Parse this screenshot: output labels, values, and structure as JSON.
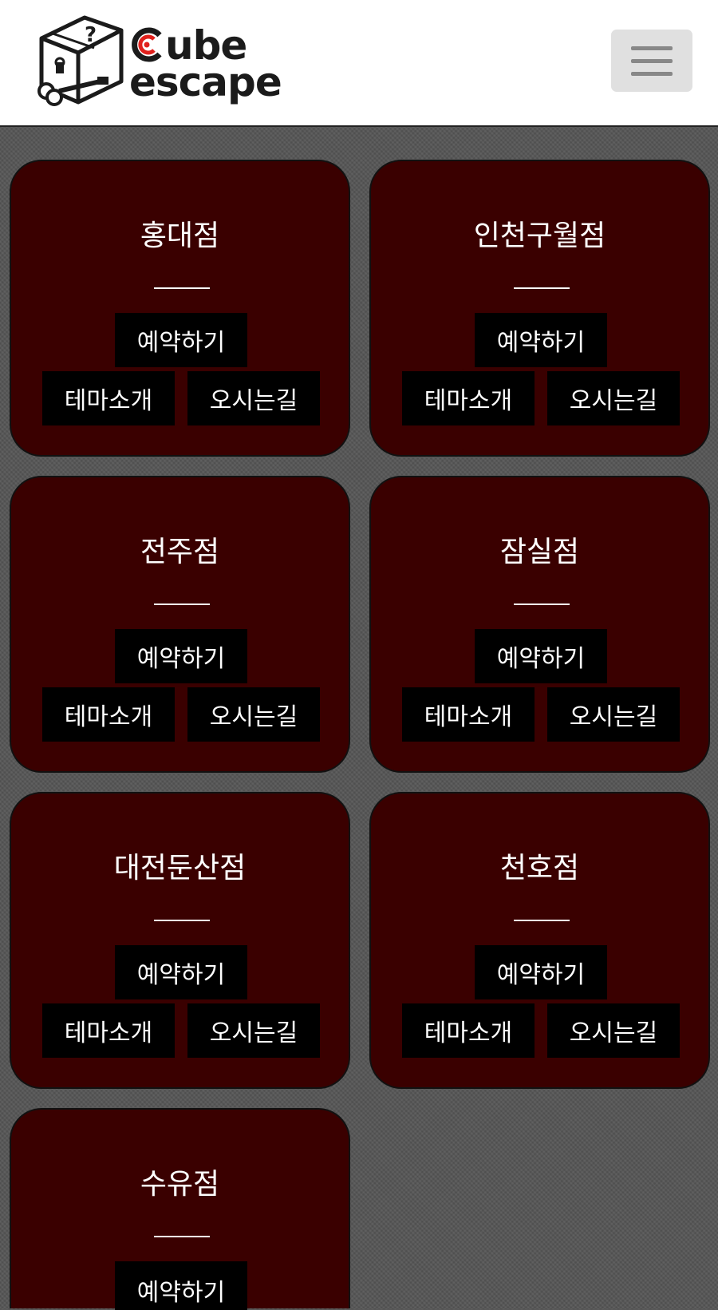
{
  "header": {
    "logo_word1_rest": "ube",
    "logo_word2": "escape",
    "logo_box_mark": "?",
    "menu_icon": "hamburger-menu-icon"
  },
  "branches": [
    {
      "name": "홍대점",
      "reserve_label": "예약하기",
      "theme_label": "테마소개",
      "route_label": "오시는길"
    },
    {
      "name": "인천구월점",
      "reserve_label": "예약하기",
      "theme_label": "테마소개",
      "route_label": "오시는길"
    },
    {
      "name": "전주점",
      "reserve_label": "예약하기",
      "theme_label": "테마소개",
      "route_label": "오시는길"
    },
    {
      "name": "잠실점",
      "reserve_label": "예약하기",
      "theme_label": "테마소개",
      "route_label": "오시는길"
    },
    {
      "name": "대전둔산점",
      "reserve_label": "예약하기",
      "theme_label": "테마소개",
      "route_label": "오시는길"
    },
    {
      "name": "천호점",
      "reserve_label": "예약하기",
      "theme_label": "테마소개",
      "route_label": "오시는길"
    },
    {
      "name": "수유점",
      "reserve_label": "예약하기"
    }
  ],
  "colors": {
    "header_bg": "#ffffff",
    "page_bg": "#555555",
    "card_bg": "#3a0000",
    "button_bg": "#000000",
    "logo_accent": "#e0201c",
    "menu_button_bg": "#e0e0e0"
  }
}
